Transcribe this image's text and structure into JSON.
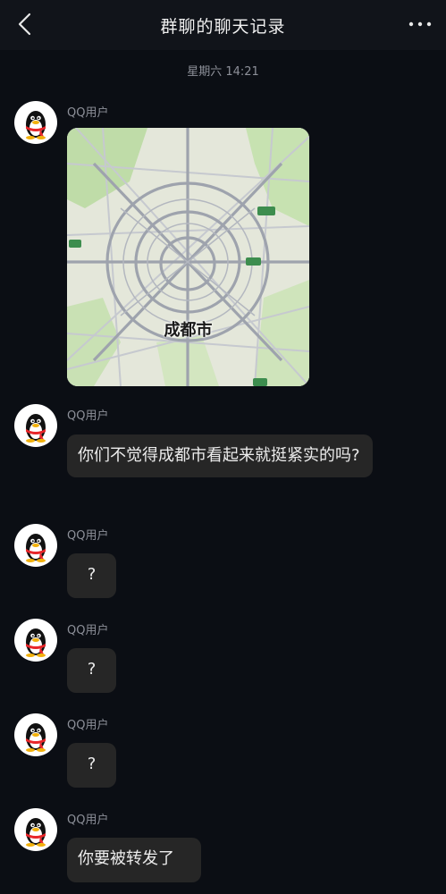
{
  "header": {
    "title": "群聊的聊天记录"
  },
  "timestamp": "星期六 14:21",
  "messages": [
    {
      "sender": "QQ用户",
      "type": "map",
      "map_label": "成都市"
    },
    {
      "sender": "QQ用户",
      "type": "text",
      "text": "你们不觉得成都市看起来就挺紧实的吗?"
    },
    {
      "sender": "QQ用户",
      "type": "text",
      "text": "?"
    },
    {
      "sender": "QQ用户",
      "type": "text",
      "text": "?"
    },
    {
      "sender": "QQ用户",
      "type": "text",
      "text": "?"
    },
    {
      "sender": "QQ用户",
      "type": "text",
      "text": "你要被转发了"
    }
  ],
  "icons": {
    "back": "back-arrow-icon",
    "more": "more-dots-icon",
    "avatar": "qq-penguin-avatar"
  },
  "colors": {
    "background": "#0b0e14",
    "bubble": "#262626",
    "secondary_text": "#8d9099"
  }
}
